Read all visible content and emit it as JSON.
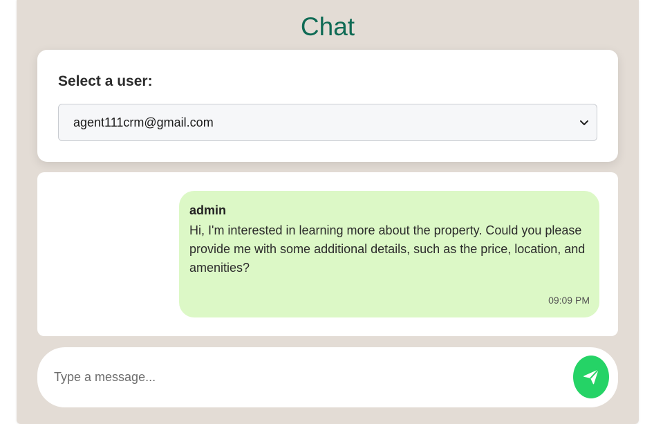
{
  "header": {
    "title": "Chat"
  },
  "user_select": {
    "label": "Select a user:",
    "selected_value": "agent111crm@gmail.com"
  },
  "messages": [
    {
      "sender": "admin",
      "text": "Hi, I'm interested in learning more about the property. Could you please provide me with some additional details, such as the price, location, and amenities?",
      "time": "09:09 PM"
    }
  ],
  "composer": {
    "placeholder": "Type a message...",
    "send_icon": "paper-plane-icon"
  },
  "colors": {
    "background": "#e3dcd5",
    "title": "#0f6b55",
    "bubble": "#dcf8c6",
    "send_button": "#25d366"
  }
}
